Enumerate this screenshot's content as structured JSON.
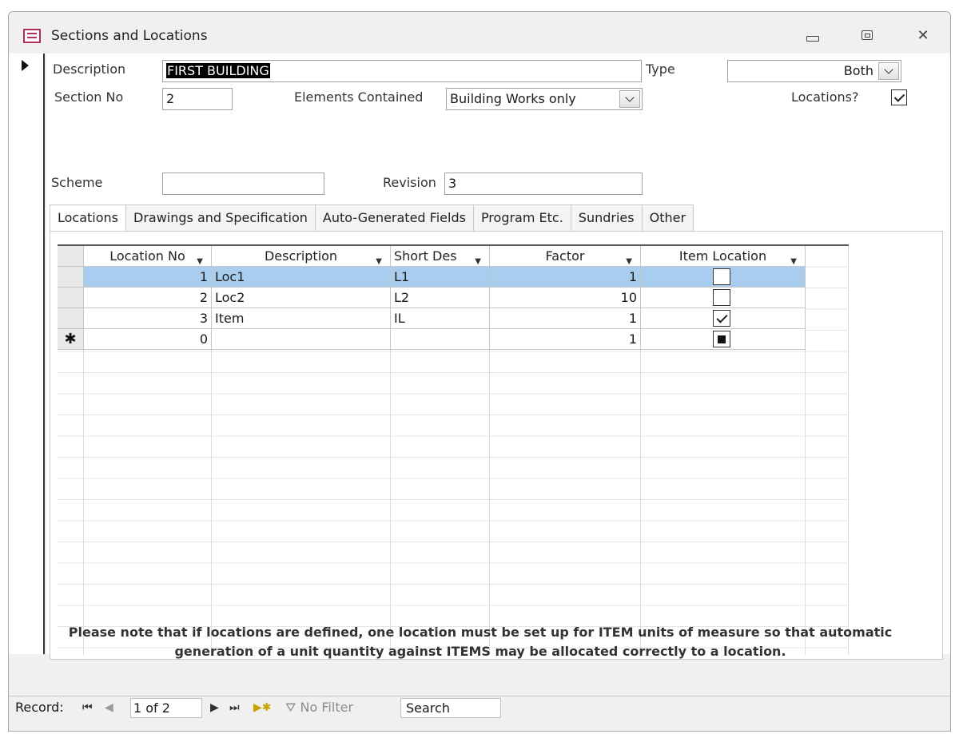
{
  "window": {
    "title": "Sections and Locations"
  },
  "form": {
    "description": {
      "label": "Description",
      "value": "FIRST BUILDING"
    },
    "type": {
      "label": "Type",
      "value": "Both"
    },
    "section_no": {
      "label": "Section No",
      "value": "2"
    },
    "elements_contained": {
      "label": "Elements Contained",
      "value": "Building Works only"
    },
    "locations_flag": {
      "label": "Locations?",
      "checked": true
    },
    "scheme": {
      "label": "Scheme",
      "value": ""
    },
    "revision": {
      "label": "Revision",
      "value": "3"
    }
  },
  "tabs": [
    {
      "label": "Locations",
      "active": true
    },
    {
      "label": "Drawings and Specification",
      "active": false
    },
    {
      "label": "Auto-Generated Fields",
      "active": false
    },
    {
      "label": "Program Etc.",
      "active": false
    },
    {
      "label": "Sundries",
      "active": false
    },
    {
      "label": "Other",
      "active": false
    }
  ],
  "grid": {
    "columns": [
      "Location No",
      "Description",
      "Short Des",
      "Factor",
      "Item Location"
    ],
    "rows": [
      {
        "location_no": "1",
        "description": "Loc1",
        "short_des": "L1",
        "factor": "1",
        "item_location": "unchecked"
      },
      {
        "location_no": "2",
        "description": "Loc2",
        "short_des": "L2",
        "factor": "10",
        "item_location": "unchecked"
      },
      {
        "location_no": "3",
        "description": "Item",
        "short_des": "IL",
        "factor": "1",
        "item_location": "checked"
      },
      {
        "location_no": "0",
        "description": "",
        "short_des": "",
        "factor": "1",
        "item_location": "indeterminate",
        "new_record_marker": "✱"
      }
    ]
  },
  "note": {
    "line1": "Please note that if locations are defined, one location must be set up for ITEM units of measure so that automatic",
    "line2": "generation of a unit quantity against ITEMS may be allocated correctly to a location."
  },
  "statusbar": {
    "record_label": "Record:",
    "record_value": "1 of 2",
    "filter_label": "No Filter",
    "search_label": "Search"
  },
  "icons": {
    "first": "first-record-icon",
    "prev": "previous-record-icon",
    "next": "next-record-icon",
    "last": "last-record-icon",
    "new": "new-record-icon",
    "filter": "filter-icon"
  }
}
